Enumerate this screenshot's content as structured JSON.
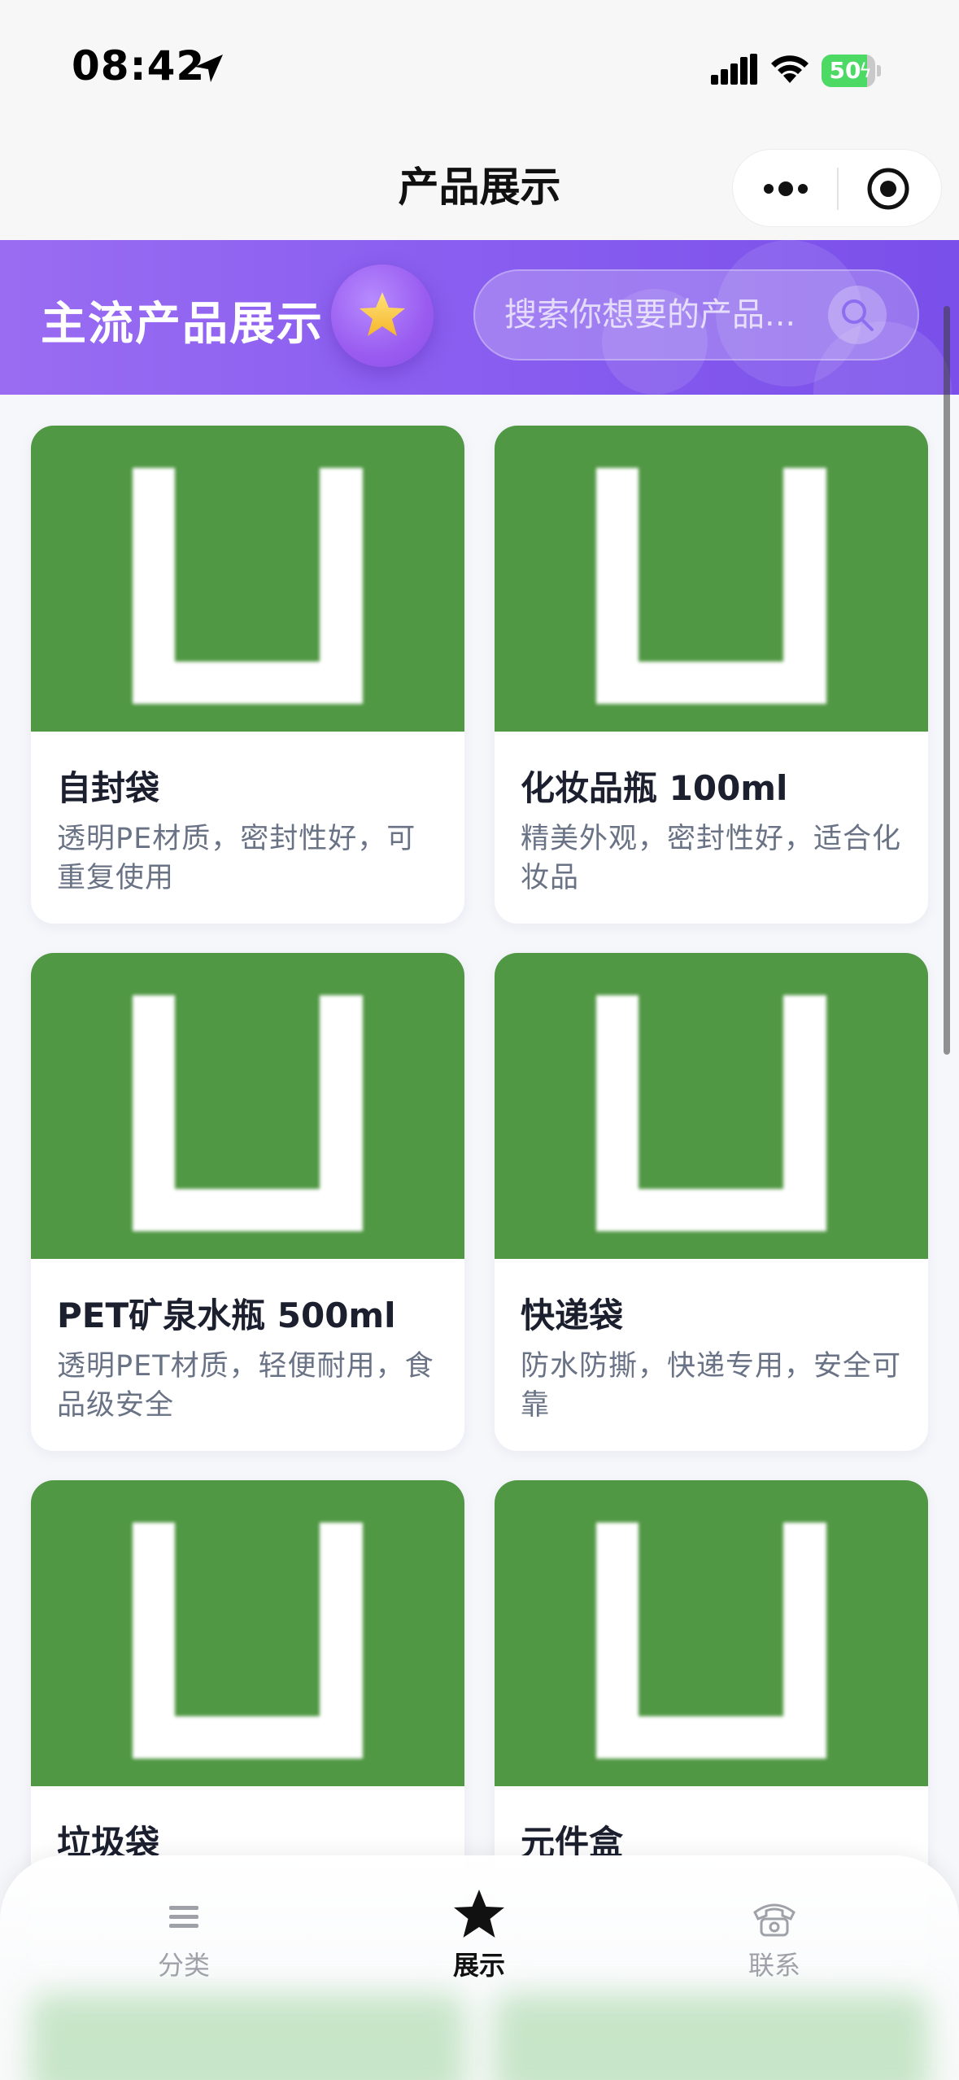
{
  "status_bar": {
    "time": "08:42",
    "battery_level": "50",
    "battery_fraction": 0.5
  },
  "nav": {
    "title": "产品展示"
  },
  "hero": {
    "title": "主流产品展示",
    "search_placeholder": "搜索你想要的产品..."
  },
  "products": [
    {
      "name": "自封袋",
      "desc": "透明PE材质，密封性好，可重复使用"
    },
    {
      "name": "化妆品瓶 100ml",
      "desc": "精美外观，密封性好，适合化妆品"
    },
    {
      "name": "PET矿泉水瓶 500ml",
      "desc": "透明PET材质，轻便耐用，食品级安全"
    },
    {
      "name": "快递袋",
      "desc": "防水防撕，快递专用，安全可靠"
    },
    {
      "name": "垃圾袋",
      "desc": ""
    },
    {
      "name": "元件盒",
      "desc": ""
    }
  ],
  "tabbar": {
    "items": [
      {
        "label": "分类",
        "icon": "menu-icon",
        "active": false
      },
      {
        "label": "展示",
        "icon": "star-icon",
        "active": true
      },
      {
        "label": "联系",
        "icon": "phone-icon",
        "active": false
      }
    ]
  },
  "colors": {
    "accent_purple": "#8a5ff0",
    "image_green": "#509844",
    "title_text": "#1b1f2e",
    "desc_text": "#6a7386"
  }
}
